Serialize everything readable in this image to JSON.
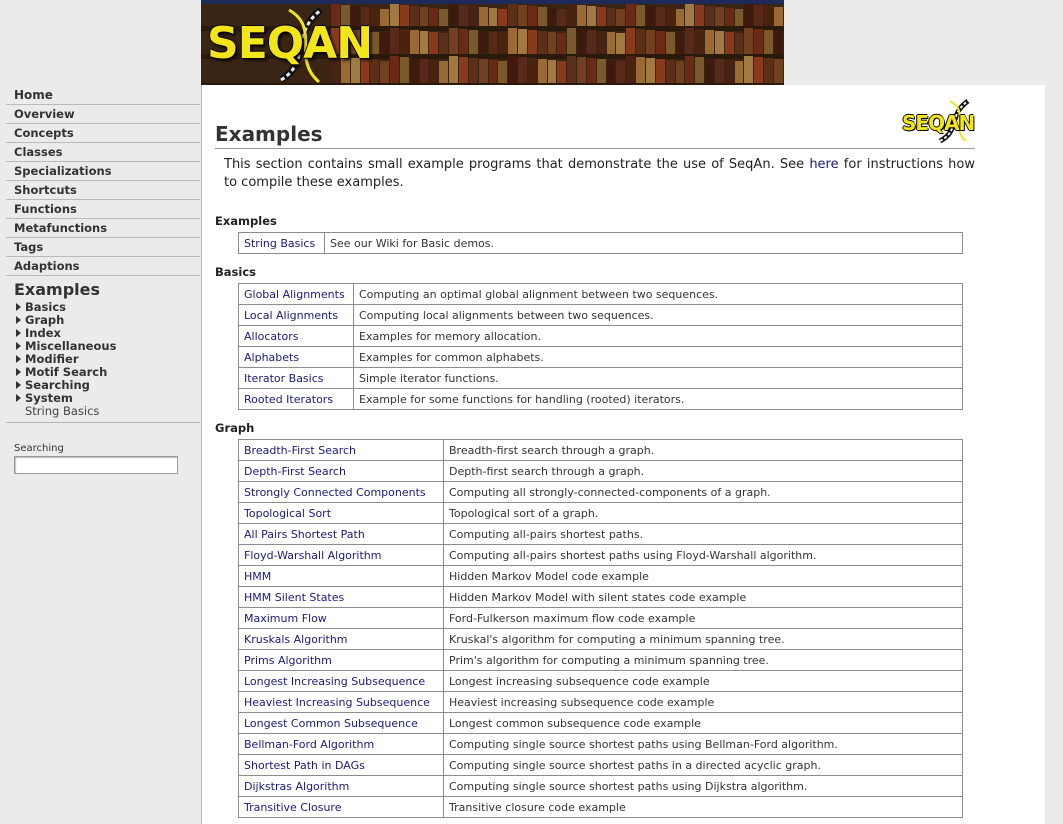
{
  "banner": {
    "logo_text": "SEQAN"
  },
  "sidebar": {
    "nav": [
      {
        "label": "Home"
      },
      {
        "label": "Overview"
      },
      {
        "label": "Concepts"
      },
      {
        "label": "Classes"
      },
      {
        "label": "Specializations"
      },
      {
        "label": "Shortcuts"
      },
      {
        "label": "Functions"
      },
      {
        "label": "Metafunctions"
      },
      {
        "label": "Tags"
      },
      {
        "label": "Adaptions"
      }
    ],
    "current": {
      "title": "Examples",
      "items": [
        {
          "label": "Basics",
          "expandable": true
        },
        {
          "label": "Graph",
          "expandable": true
        },
        {
          "label": "Index",
          "expandable": true
        },
        {
          "label": "Miscellaneous",
          "expandable": true
        },
        {
          "label": "Modifier",
          "expandable": true
        },
        {
          "label": "Motif Search",
          "expandable": true
        },
        {
          "label": "Searching",
          "expandable": true
        },
        {
          "label": "System",
          "expandable": true
        },
        {
          "label": "String Basics",
          "expandable": false
        }
      ]
    },
    "search": {
      "label": "Searching",
      "value": "",
      "placeholder": ""
    }
  },
  "main": {
    "logo_text": "SEQAN",
    "title": "Examples",
    "intro": {
      "before": "This section contains small example programs that demonstrate the use of SeqAn. See ",
      "link": "here",
      "after": " for instructions how to compile these examples."
    },
    "sections": [
      {
        "heading": "Examples",
        "rows": [
          {
            "name": "String Basics",
            "desc": "See our Wiki for Basic demos."
          }
        ]
      },
      {
        "heading": "Basics",
        "rows": [
          {
            "name": "Global Alignments",
            "desc": "Computing an optimal global alignment between two sequences."
          },
          {
            "name": "Local Alignments",
            "desc": "Computing local alignments between two sequences."
          },
          {
            "name": "Allocators",
            "desc": "Examples for memory allocation."
          },
          {
            "name": "Alphabets",
            "desc": "Examples for common alphabets."
          },
          {
            "name": "Iterator Basics",
            "desc": "Simple iterator functions."
          },
          {
            "name": "Rooted Iterators",
            "desc": "Example for some functions for handling (rooted) iterators."
          }
        ]
      },
      {
        "heading": "Graph",
        "rows": [
          {
            "name": "Breadth-First Search",
            "desc": "Breadth-first search through a graph."
          },
          {
            "name": "Depth-First Search",
            "desc": "Depth-first search through a graph."
          },
          {
            "name": "Strongly Connected Components",
            "desc": "Computing all strongly-connected-components of a graph."
          },
          {
            "name": "Topological Sort",
            "desc": "Topological sort of a graph."
          },
          {
            "name": "All Pairs Shortest Path",
            "desc": "Computing all-pairs shortest paths."
          },
          {
            "name": "Floyd-Warshall Algorithm",
            "desc": "Computing all-pairs shortest paths using Floyd-Warshall algorithm."
          },
          {
            "name": "HMM",
            "desc": "Hidden Markov Model code example"
          },
          {
            "name": "HMM Silent States",
            "desc": "Hidden Markov Model with silent states code example"
          },
          {
            "name": "Maximum Flow",
            "desc": "Ford-Fulkerson maximum flow code example"
          },
          {
            "name": "Kruskals Algorithm",
            "desc": "Kruskal's algorithm for computing a minimum spanning tree."
          },
          {
            "name": "Prims Algorithm",
            "desc": "Prim's algorithm for computing a minimum spanning tree."
          },
          {
            "name": "Longest Increasing Subsequence",
            "desc": "Longest increasing subsequence code example"
          },
          {
            "name": "Heaviest Increasing Subsequence",
            "desc": "Heaviest increasing subsequence code example"
          },
          {
            "name": "Longest Common Subsequence",
            "desc": "Longest common subsequence code example"
          },
          {
            "name": "Bellman-Ford Algorithm",
            "desc": "Computing single source shortest paths using Bellman-Ford algorithm."
          },
          {
            "name": "Shortest Path in DAGs",
            "desc": "Computing single source shortest paths in a directed acyclic graph."
          },
          {
            "name": "Dijkstras Algorithm",
            "desc": "Computing single source shortest paths using Dijkstra algorithm."
          },
          {
            "name": "Transitive Closure",
            "desc": "Transitive closure code example"
          }
        ]
      }
    ]
  },
  "colors": {
    "link": "#1a1a7a",
    "logo_yellow": "#f2e61a",
    "page_bg": "#ebebeb"
  }
}
